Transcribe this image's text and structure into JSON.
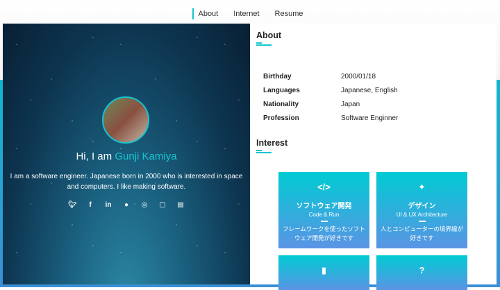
{
  "nav": {
    "items": [
      "About",
      "Internet",
      "Resume"
    ]
  },
  "profile": {
    "greeting": "Hi, I am",
    "name": "Gunji Kamiya",
    "bio": "I am a software engineer. Japanese born in 2000 who is interested in space and computers. I like making software.",
    "social": [
      "twitter-icon",
      "facebook-icon",
      "linkedin-icon",
      "github-icon",
      "instagram-icon",
      "note-icon",
      "blog-icon"
    ]
  },
  "about": {
    "title": "About",
    "rows": [
      {
        "k": "Birthday",
        "v": "2000/01/18"
      },
      {
        "k": "Languages",
        "v": "Japanese, English"
      },
      {
        "k": "Nationality",
        "v": "Japan"
      },
      {
        "k": "Profession",
        "v": "Software Enginner"
      }
    ]
  },
  "interest": {
    "title": "Interest",
    "cards": [
      {
        "icon": "</>",
        "title": "ソフトウェア開発",
        "sub": "Code & Run",
        "desc": "フレームワークを使ったソフトウェア開発が好きです"
      },
      {
        "icon": "✦",
        "title": "デザイン",
        "sub": "UI & UX Architecture",
        "desc": "人とコンピューターの境界線が好きです"
      },
      {
        "icon": "▮"
      },
      {
        "icon": "?"
      }
    ]
  },
  "colors": {
    "accent": "#16c5d0"
  }
}
